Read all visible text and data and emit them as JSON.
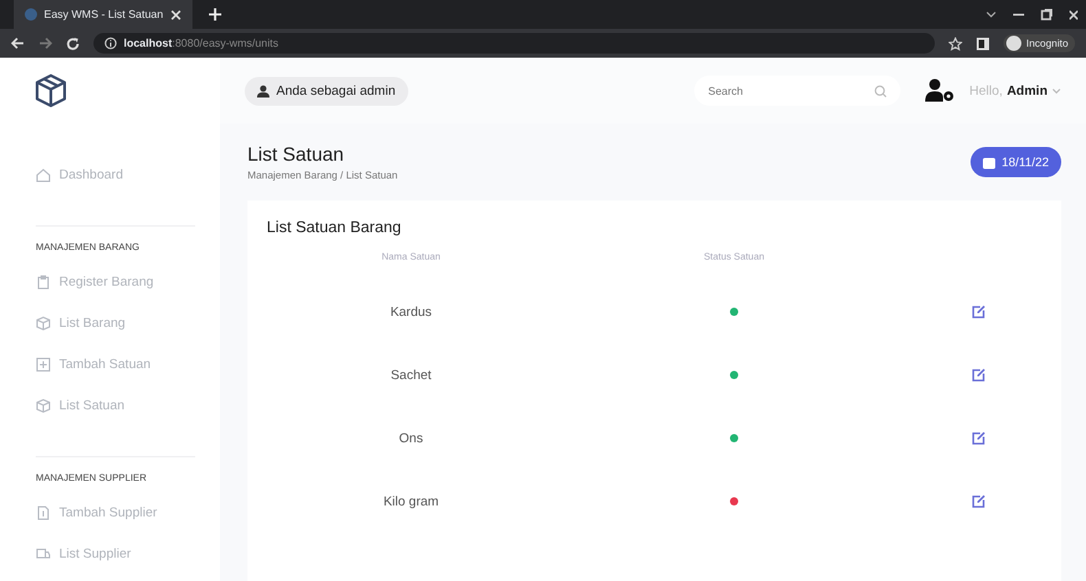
{
  "browser": {
    "tab_title": "Easy WMS - List Satuan",
    "url_host": "localhost",
    "url_path": ":8080/easy-wms/units",
    "profile": "Incognito"
  },
  "topbar": {
    "role_badge": "Anda sebagai admin",
    "search": {
      "placeholder": "Search"
    },
    "greeting": "Hello,",
    "user": "Admin"
  },
  "sidebar": {
    "items": [
      {
        "kind": "link",
        "label": "Dashboard",
        "selected": false
      },
      {
        "kind": "section",
        "label": "MANAJEMEN BARANG"
      },
      {
        "kind": "link",
        "label": "Register Barang",
        "selected": false
      },
      {
        "kind": "link",
        "label": "List Barang",
        "selected": false
      },
      {
        "kind": "link",
        "label": "Tambah Satuan",
        "selected": false
      },
      {
        "kind": "link",
        "label": "List Satuan",
        "selected": false
      },
      {
        "kind": "section",
        "label": "MANAJEMEN SUPPLIER"
      },
      {
        "kind": "link",
        "label": "Tambah Supplier",
        "selected": false
      },
      {
        "kind": "link",
        "label": "List Supplier",
        "selected": false
      }
    ]
  },
  "page": {
    "title": "List Satuan",
    "breadcrumb": "Manajemen Barang / List Satuan",
    "date": "18/11/22"
  },
  "table": {
    "title": "List Satuan Barang",
    "columns": [
      "Nama Satuan",
      "Status Satuan"
    ],
    "rows": [
      {
        "name": "Kardus",
        "color": "#22b573"
      },
      {
        "name": "Sachet",
        "color": "#22b573"
      },
      {
        "name": "Ons",
        "color": "#22b573"
      },
      {
        "name": "Kilo gram",
        "color": "#e8384f"
      }
    ]
  }
}
